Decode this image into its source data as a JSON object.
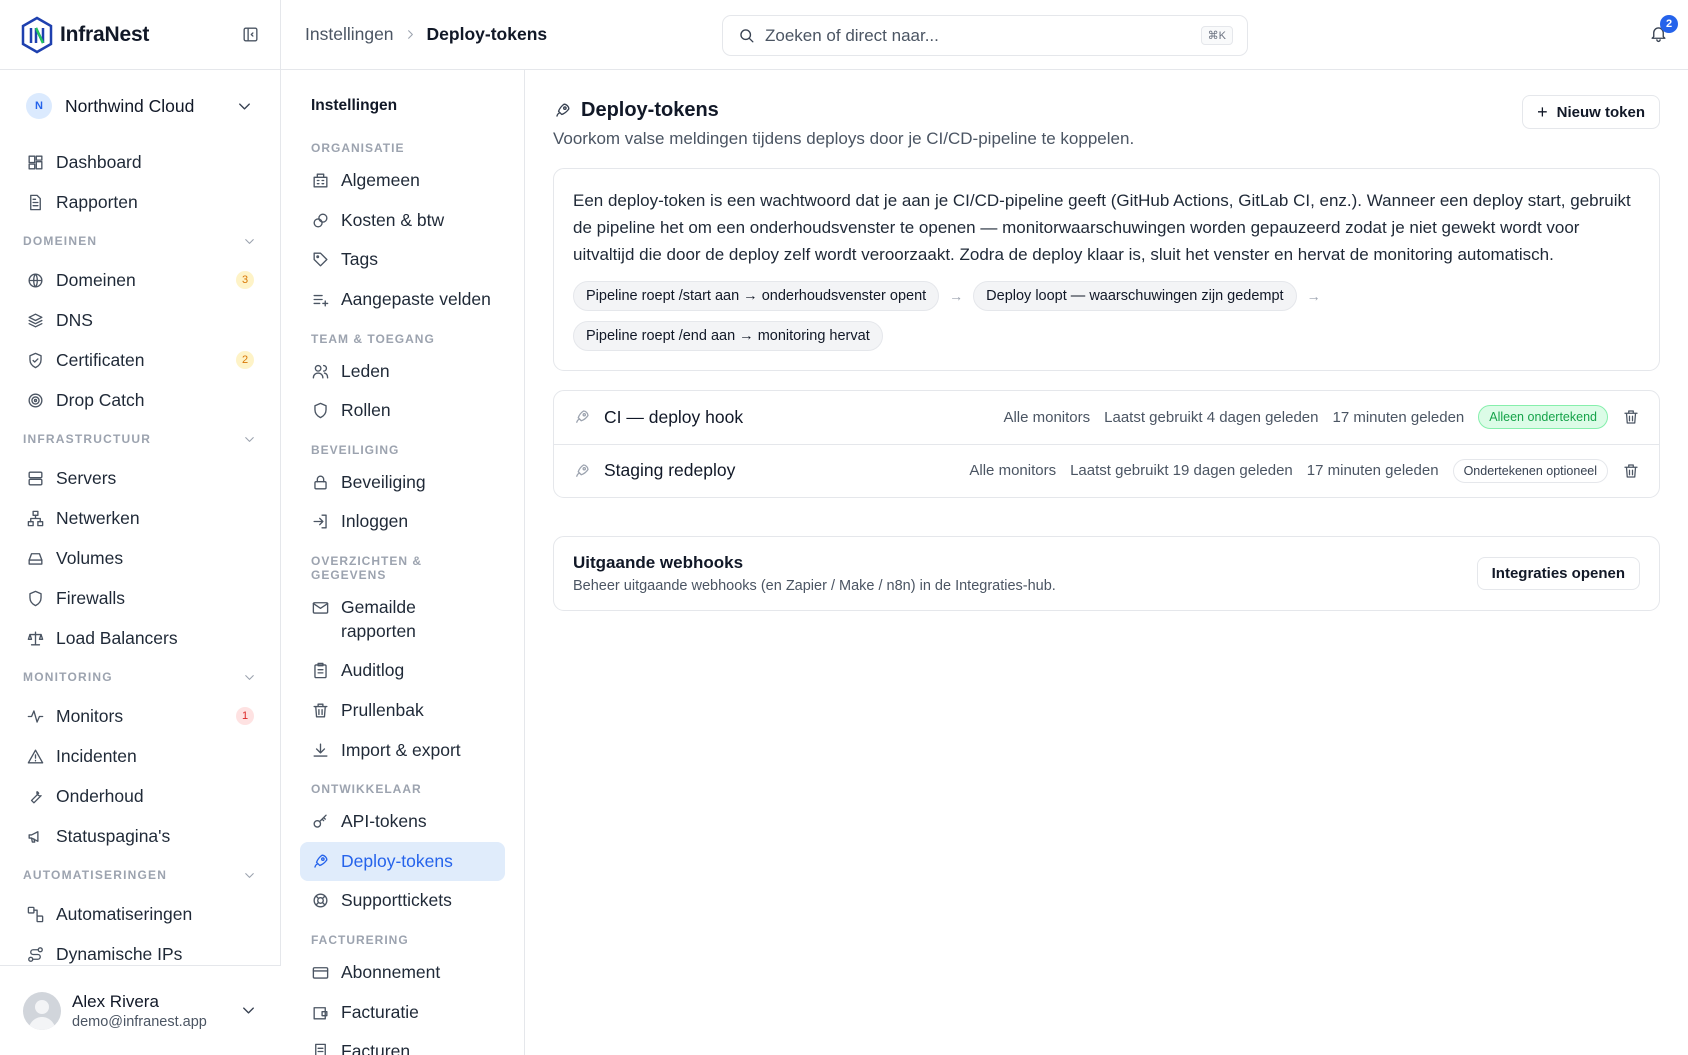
{
  "brand": {
    "name": "InfraNest"
  },
  "org": {
    "initial": "N",
    "name": "Northwind Cloud"
  },
  "sidebar": {
    "top": [
      {
        "label": "Dashboard"
      },
      {
        "label": "Rapporten"
      }
    ],
    "domains_title": "DOMEINEN",
    "domains": [
      {
        "label": "Domeinen",
        "badge": "3"
      },
      {
        "label": "DNS"
      },
      {
        "label": "Certificaten",
        "badge": "2"
      },
      {
        "label": "Drop Catch"
      }
    ],
    "infra_title": "INFRASTRUCTUUR",
    "infra": [
      {
        "label": "Servers"
      },
      {
        "label": "Netwerken"
      },
      {
        "label": "Volumes"
      },
      {
        "label": "Firewalls"
      },
      {
        "label": "Load Balancers"
      }
    ],
    "monitoring_title": "MONITORING",
    "monitoring": [
      {
        "label": "Monitors",
        "badge": "1"
      },
      {
        "label": "Incidenten"
      },
      {
        "label": "Onderhoud"
      },
      {
        "label": "Statuspagina's"
      }
    ],
    "automation_title": "AUTOMATISERINGEN",
    "automation": [
      {
        "label": "Automatiseringen"
      },
      {
        "label": "Dynamische IPs"
      }
    ]
  },
  "user": {
    "name": "Alex Rivera",
    "email": "demo@infranest.app"
  },
  "topbar": {
    "crumb1": "Instellingen",
    "crumb2": "Deploy-tokens",
    "search_placeholder": "Zoeken of direct naar...",
    "shortcut": "⌘K",
    "notifications": "2"
  },
  "settings_nav": {
    "title": "Instellingen",
    "sections": [
      {
        "title": "ORGANISATIE",
        "items": [
          "Algemeen",
          "Kosten & btw",
          "Tags",
          "Aangepaste velden"
        ]
      },
      {
        "title": "TEAM & TOEGANG",
        "items": [
          "Leden",
          "Rollen"
        ]
      },
      {
        "title": "BEVEILIGING",
        "items": [
          "Beveiliging",
          "Inloggen"
        ]
      },
      {
        "title": "OVERZICHTEN & GEGEVENS",
        "items": [
          "Gemailde rapporten",
          "Auditlog",
          "Prullenbak",
          "Import & export"
        ]
      },
      {
        "title": "ONTWIKKELAAR",
        "items": [
          "API-tokens",
          "Deploy-tokens",
          "Supporttickets"
        ]
      },
      {
        "title": "FACTURERING",
        "items": [
          "Abonnement",
          "Facturatie",
          "Facturen"
        ]
      }
    ]
  },
  "main": {
    "title": "Deploy-tokens",
    "subtitle": "Voorkom valse meldingen tijdens deploys door je CI/CD-pipeline te koppelen.",
    "new_token": "Nieuw token",
    "explanation": "Een deploy-token is een wachtwoord dat je aan je CI/CD-pipeline geeft (GitHub Actions, GitLab CI, enz.). Wanneer een deploy start, gebruikt de pipeline het om een onderhoudsvenster te openen — monitorwaarschuwingen worden gepauzeerd zodat je niet gewekt wordt voor uitvaltijd die door de deploy zelf wordt veroorzaakt. Zodra de deploy klaar is, sluit het venster en hervat de monitoring automatisch.",
    "steps": [
      "Pipeline roept /start aan → onderhoudsvenster opent",
      "Deploy loopt — waarschuwingen zijn gedempt",
      "Pipeline roept /end aan → monitoring hervat"
    ],
    "step_arrow": "→",
    "tokens": [
      {
        "name": "CI — deploy hook",
        "scope": "Alle monitors",
        "last_used": "Laatst gebruikt 4 dagen geleden",
        "created": "17 minuten geleden",
        "signing": "Alleen ondertekend"
      },
      {
        "name": "Staging redeploy",
        "scope": "Alle monitors",
        "last_used": "Laatst gebruikt 19 dagen geleden",
        "created": "17 minuten geleden",
        "signing": "Ondertekenen optioneel"
      }
    ],
    "webhooks": {
      "title": "Uitgaande webhooks",
      "subtitle": "Beheer uitgaande webhooks (en Zapier / Make / n8n) in de Integraties-hub.",
      "button": "Integraties openen"
    }
  },
  "colors": {
    "accent": "#2563eb",
    "active_bg": "#e0ecfb",
    "success": "#16a34a",
    "warning": "#d97706",
    "danger": "#dc2626"
  },
  "icons": {
    "top": [
      "dashboard-icon",
      "report-icon"
    ],
    "domains": [
      "globe-icon",
      "layers-icon",
      "shield-check-icon",
      "target-icon"
    ],
    "infra": [
      "server-icon",
      "network-icon",
      "drive-icon",
      "shield-icon",
      "scale-icon"
    ],
    "monitoring": [
      "activity-icon",
      "alert-triangle-icon",
      "wrench-icon",
      "megaphone-icon"
    ],
    "automation": [
      "workflow-icon",
      "route-icon"
    ]
  }
}
